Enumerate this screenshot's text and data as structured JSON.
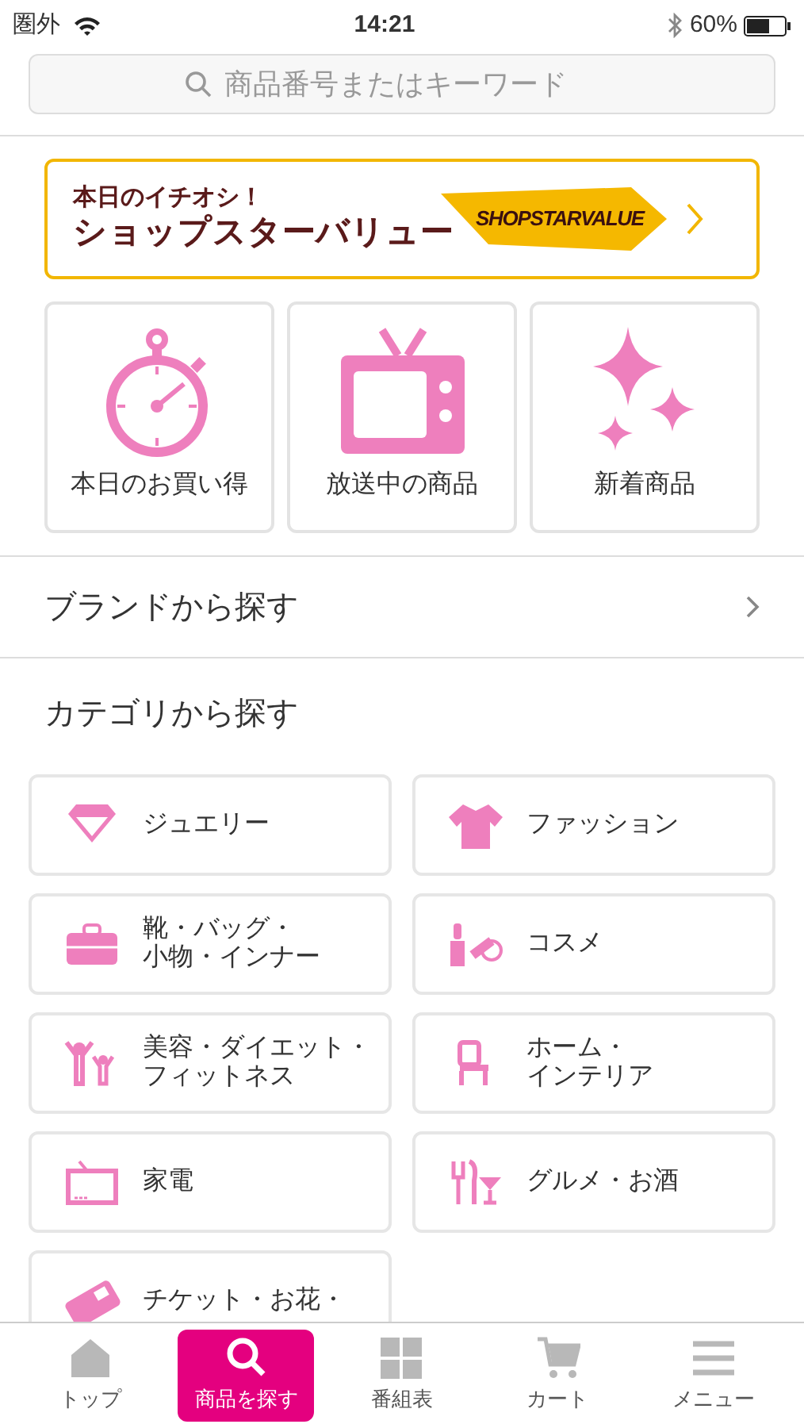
{
  "status_bar": {
    "carrier": "圏外",
    "time": "14:21",
    "battery": "60%"
  },
  "search": {
    "placeholder": "商品番号またはキーワード"
  },
  "banner": {
    "kicker": "本日のイチオシ！",
    "title": "ショップスターバリュー",
    "logo_text": "SHOPSTARVALUE"
  },
  "quick_links": [
    {
      "label": "本日のお買い得"
    },
    {
      "label": "放送中の商品"
    },
    {
      "label": "新着商品"
    }
  ],
  "brand_row": {
    "label": "ブランドから探す"
  },
  "categories_heading": "カテゴリから探す",
  "categories": [
    {
      "lines": [
        "ジュエリー"
      ]
    },
    {
      "lines": [
        "ファッション"
      ]
    },
    {
      "lines": [
        "靴・バッグ・",
        "小物・インナー"
      ]
    },
    {
      "lines": [
        "コスメ"
      ]
    },
    {
      "lines": [
        "美容・ダイエット・",
        "フィットネス"
      ]
    },
    {
      "lines": [
        "ホーム・",
        "インテリア"
      ]
    },
    {
      "lines": [
        "家電"
      ]
    },
    {
      "lines": [
        "グルメ・お酒"
      ]
    },
    {
      "lines": [
        "チケット・お花・"
      ]
    }
  ],
  "tab_bar": [
    {
      "label": "トップ",
      "selected": false
    },
    {
      "label": "商品を探す",
      "selected": true
    },
    {
      "label": "番組表",
      "selected": false
    },
    {
      "label": "カート",
      "selected": false
    },
    {
      "label": "メニュー",
      "selected": false
    }
  ]
}
